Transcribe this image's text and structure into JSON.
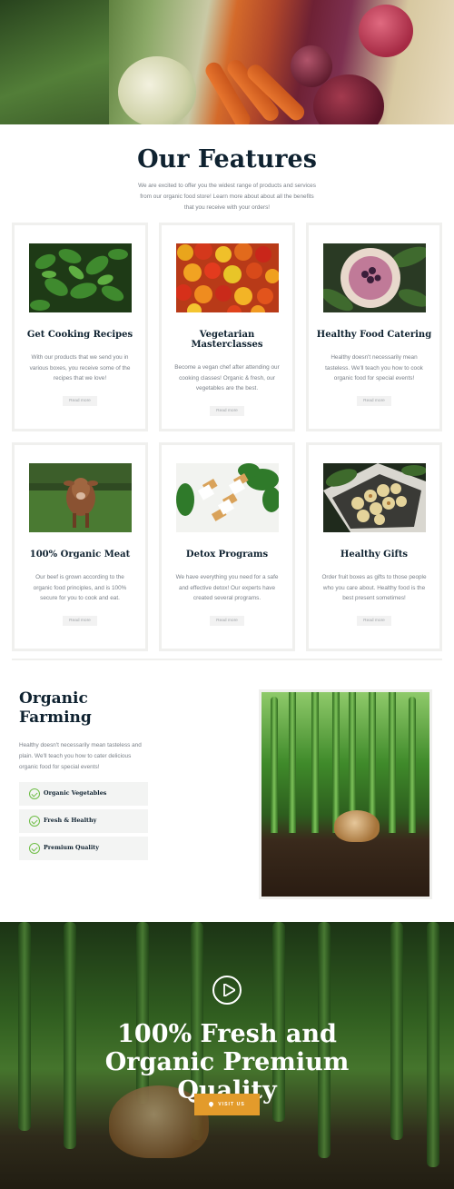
{
  "hero": {
    "image": "fresh-vegetables-photo"
  },
  "features": {
    "title": "Our Features",
    "intro": "We are excited to offer you the widest range of products and services from our organic food store! Learn more about about all the benefits that you receive with your orders!",
    "cards": [
      {
        "title": "Get Cooking Recipes",
        "text": "With our products that we send you in various boxes, you receive some of the recipes that we love!",
        "button": "Read more",
        "image": "basil-leaves-photo"
      },
      {
        "title": "Vegetarian Masterclasses",
        "text": "Become a vegan chef after attending our cooking classes! Organic & fresh, our vegetables are the best.",
        "button": "Read more",
        "image": "bell-peppers-photo"
      },
      {
        "title": "Healthy Food Catering",
        "text": "Healthy doesn't necessarily mean tasteless. We'll teach you how to cook organic food for special events!",
        "button": "Read more",
        "image": "smoothie-bowl-photo"
      },
      {
        "title": "100% Organic Meat",
        "text": "Our beef is grown according to the organic food principles, and is 100% secure for you to cook and eat.",
        "button": "Read more",
        "image": "cow-in-field-photo"
      },
      {
        "title": "Detox Programs",
        "text": "We have everything you need for a safe and effective detox! Our experts have created several programs.",
        "button": "Read more",
        "image": "detox-bottles-photo"
      },
      {
        "title": "Healthy Gifts",
        "text": "Order fruit boxes as gifts to those people who you care about. Healthy food is the best present sometimes!",
        "button": "Read more",
        "image": "fruit-box-photo"
      }
    ]
  },
  "organic": {
    "title": "Organic Farming",
    "text": "Healthy doesn't necessarily mean tasteless and plain. We'll teach you how to cater delicious organic food for special events!",
    "items": [
      "Organic Vegetables",
      "Fresh & Healthy",
      "Premium Quality"
    ],
    "image": "onion-sprouts-photo"
  },
  "cta": {
    "title": "100% Fresh and Organic Premium Quality",
    "button": "VISIT US"
  },
  "colors": {
    "accent": "#e39b2b",
    "check": "#6ebd45",
    "heading": "#0f2230"
  }
}
